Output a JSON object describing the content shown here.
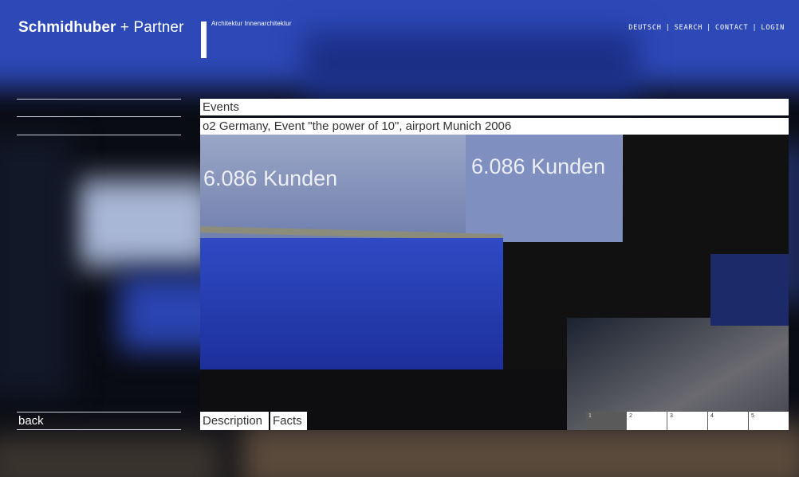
{
  "header": {
    "logo_bold": "Schmidhuber",
    "logo_plus": " + ",
    "logo_light": "Partner",
    "tagline": "Architektur  Innenarchitektur",
    "nav": [
      "DEUTSCH",
      "SEARCH",
      "CONTACT",
      "LOGIN"
    ],
    "nav_separator": "|"
  },
  "content": {
    "category": "Events",
    "project_title": "o2 Germany, Event \"the power of 10\", airport Munich 2006",
    "photo_caption_text": "6.086 Kunden"
  },
  "footer": {
    "back_label": "back",
    "tabs": [
      "Description",
      "Facts"
    ],
    "pages": [
      "1",
      "2",
      "3",
      "4",
      "5"
    ],
    "active_page": "1"
  },
  "colors": {
    "bar_bg": "#ffffff",
    "bar_text": "#333333",
    "active_page_bg": "#5a5a5a",
    "background_blue": "#2d49b8"
  }
}
